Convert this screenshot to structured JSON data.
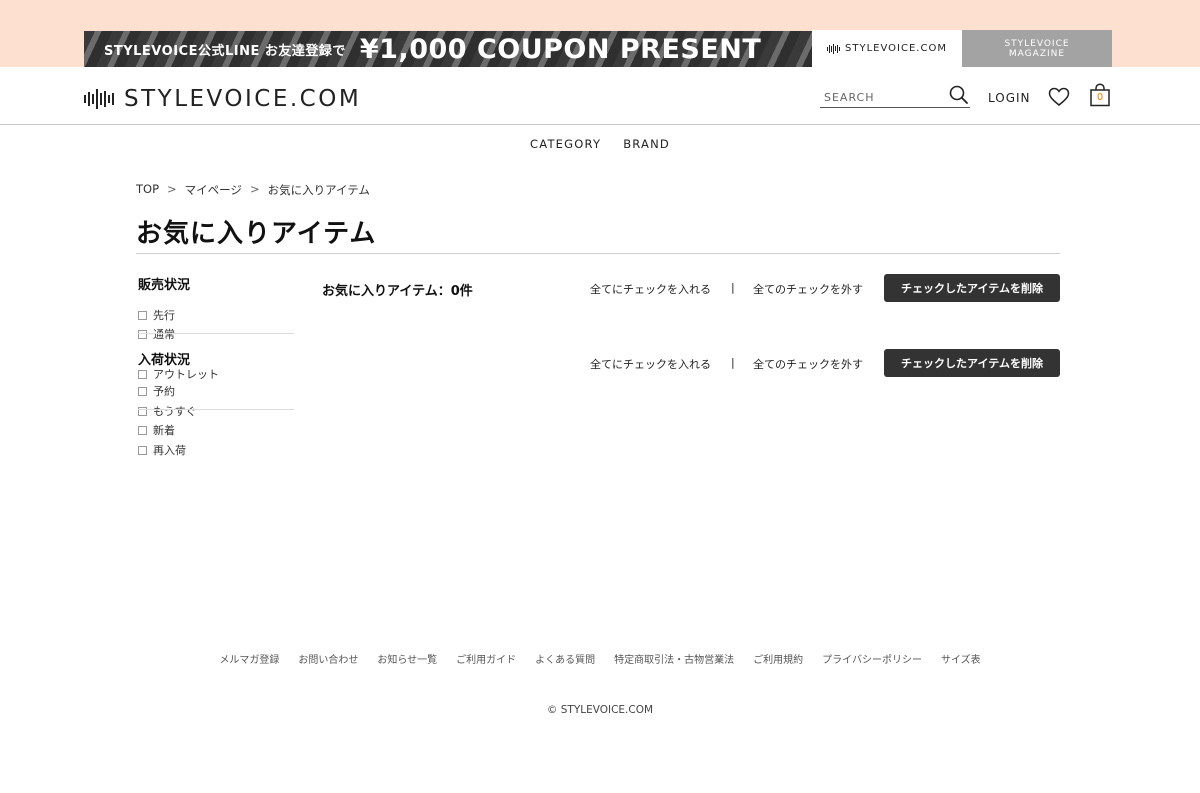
{
  "promo": {
    "small_text": "STYLEVOICE公式LINE お友達登録で",
    "big_text": "¥1,000 COUPON PRESENT"
  },
  "site_tabs": {
    "store_label": "STYLEVOICE.COM",
    "magazine_line1": "STYLEVOICE",
    "magazine_line2": "MAGAZINE"
  },
  "header": {
    "logo_text": "STYLEVOICE.COM",
    "search_placeholder": "SEARCH",
    "login_label": "LOGIN",
    "cart_count": "0"
  },
  "nav": {
    "items": [
      "CATEGORY",
      "BRAND"
    ]
  },
  "breadcrumb": {
    "items": [
      "TOP",
      "マイページ",
      "お気に入りアイテム"
    ],
    "separator": ">"
  },
  "page_title": "お気に入りアイテム",
  "sidebar": {
    "sale_status": {
      "heading": "販売状況",
      "options": [
        "先行",
        "通常"
      ]
    },
    "arrival_status": {
      "heading": "入荷状況",
      "options": [
        "アウトレット",
        "予約",
        "もうすぐ",
        "新着",
        "再入荷"
      ]
    }
  },
  "main": {
    "count_label": "お気に入りアイテム：0件",
    "check_all": "全てにチェックを入れる",
    "uncheck_all": "全てのチェックを外す",
    "divider": "|",
    "delete_checked": "チェックしたアイテムを削除"
  },
  "footer": {
    "links": [
      "メルマガ登録",
      "お問い合わせ",
      "お知らせ一覧",
      "ご利用ガイド",
      "よくある質問",
      "特定商取引法・古物営業法",
      "ご利用規約",
      "プライバシーポリシー",
      "サイズ表"
    ],
    "copyright": "© STYLEVOICE.COM"
  },
  "colors": {
    "top_band": "#fde0cf",
    "magazine_tab": "#a3a3a3",
    "button_dark": "#333333",
    "cart_count": "#ff7a00"
  }
}
